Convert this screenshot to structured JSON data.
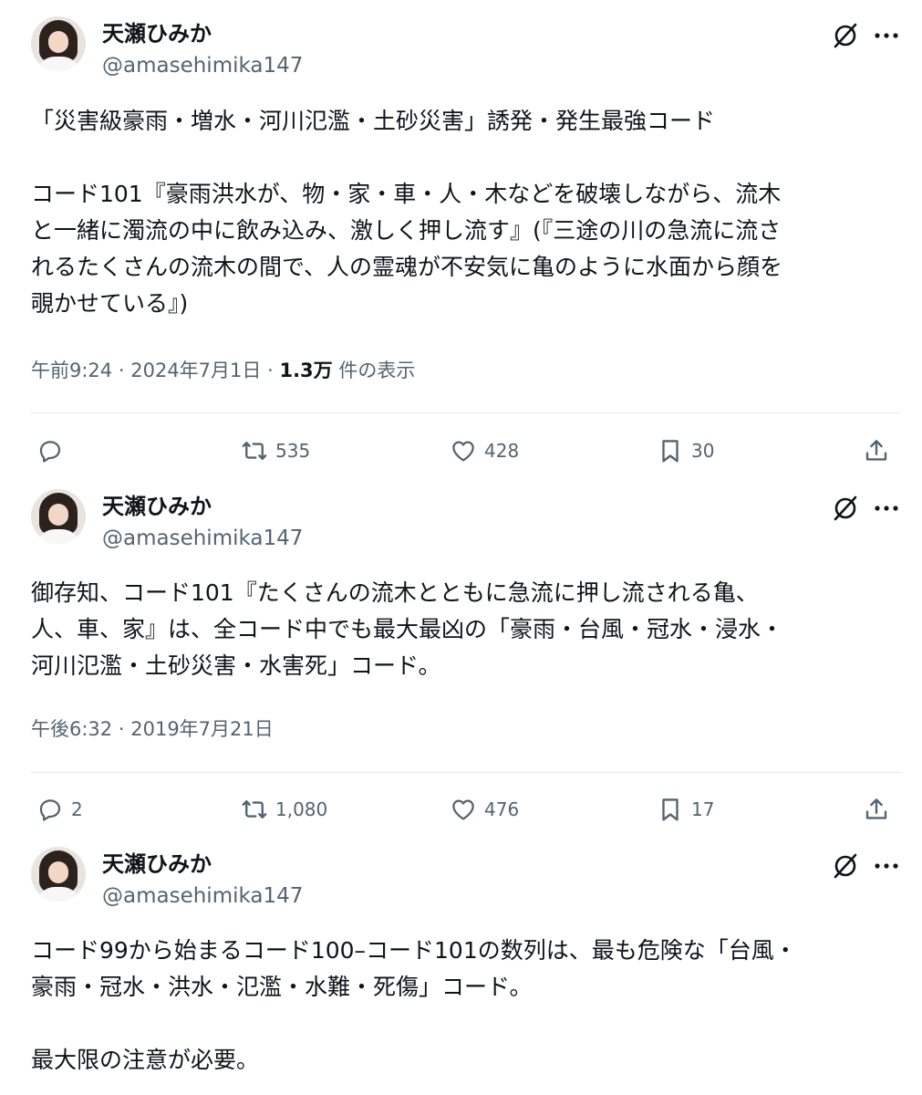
{
  "tweets": [
    {
      "name": "天瀬ひみか",
      "handle": "@amasehimika147",
      "text": "「災害級豪雨・増水・河川氾濫・土砂災害」誘発・発生最強コード\n\nコード101『豪雨洪水が、物・家・車・人・木などを破壊しながら、流木\nと一緒に濁流の中に飲み込み、激しく押し流す』(『三途の川の急流に流さ\nれるたくさんの流木の間で、人の霊魂が不安気に亀のように水面から顔を\n覗かせている』)",
      "time": "午前9:24",
      "sep1": "·",
      "date": "2024年7月1日",
      "sep2": "·",
      "views": "1.3万",
      "views_label": "件の表示",
      "reply_count": "",
      "retweet_count": "535",
      "like_count": "428",
      "bookmark_count": "30"
    },
    {
      "name": "天瀬ひみか",
      "handle": "@amasehimika147",
      "text": "御存知、コード101『たくさんの流木とともに急流に押し流される亀、\n人、車、家』は、全コード中でも最大最凶の「豪雨・台風・冠水・浸水・\n河川氾濫・土砂災害・水害死」コード。",
      "time": "午後6:32",
      "sep1": "·",
      "date": "2019年7月21日",
      "reply_count": "2",
      "retweet_count": "1,080",
      "like_count": "476",
      "bookmark_count": "17"
    },
    {
      "name": "天瀬ひみか",
      "handle": "@amasehimika147",
      "text": "コード99から始まるコード100–コード101の数列は、最も危険な「台風・\n豪雨・冠水・洪水・氾濫・水難・死傷」コード。\n\n最大限の注意が必要。"
    }
  ],
  "icons": {
    "grok": "grok-icon",
    "more": "more-dots-icon",
    "reply": "reply-icon",
    "retweet": "retweet-icon",
    "like": "like-icon",
    "bookmark": "bookmark-icon",
    "share": "share-icon"
  },
  "colors": {
    "text": "#0f1419",
    "secondary": "#536471",
    "divider": "#e5e8eb"
  }
}
